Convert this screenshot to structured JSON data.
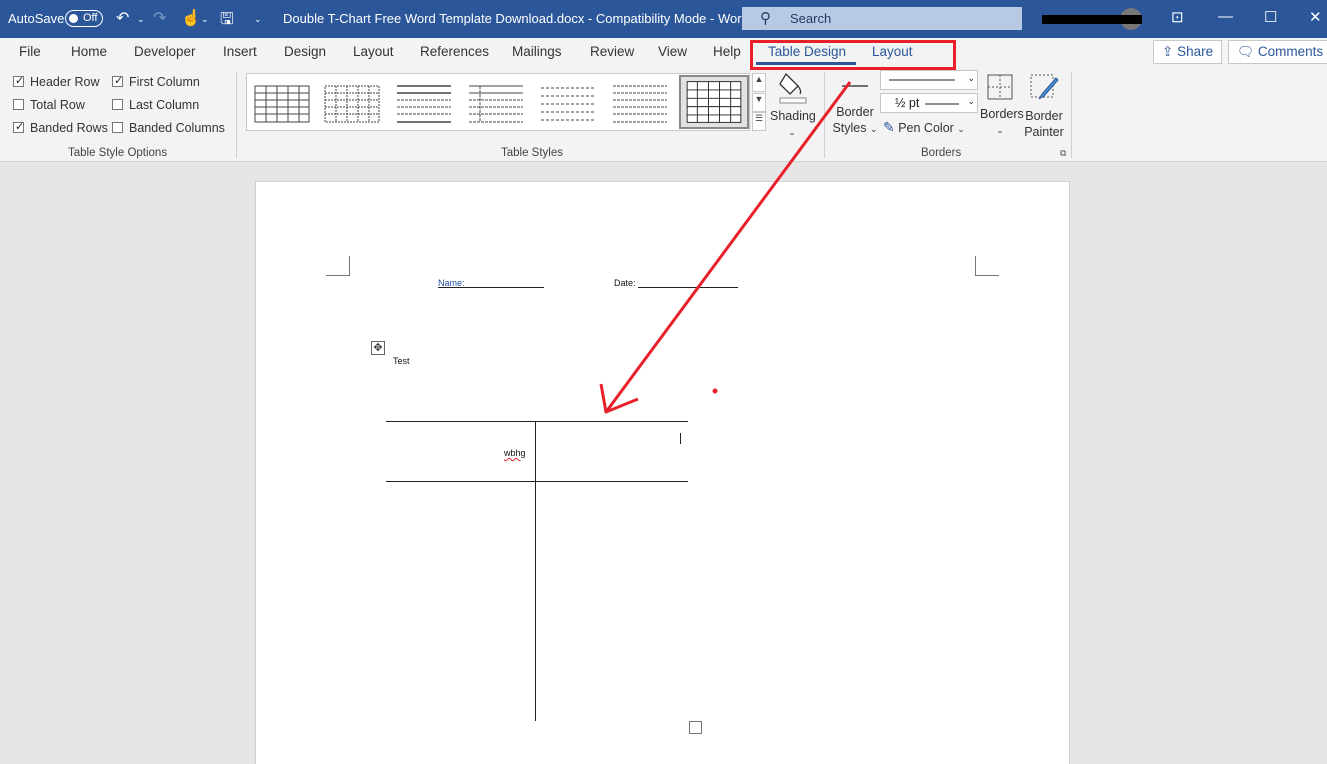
{
  "titlebar": {
    "autosave_label": "AutoSave",
    "autosave_state": "Off",
    "doc_title": "Double T-Chart Free Word Template Download.docx  -  Compatibility Mode  -  Word",
    "search_placeholder": "Search"
  },
  "tabs": [
    "File",
    "Home",
    "Developer",
    "Insert",
    "Design",
    "Layout",
    "References",
    "Mailings",
    "Review",
    "View",
    "Help",
    "Table Design",
    "Layout"
  ],
  "active_tab_index": 11,
  "share_label": "Share",
  "comments_label": "Comments",
  "table_style_options": {
    "group_label": "Table Style Options",
    "options": [
      {
        "label": "Header Row",
        "checked": true
      },
      {
        "label": "First Column",
        "checked": true
      },
      {
        "label": "Total Row",
        "checked": false
      },
      {
        "label": "Last Column",
        "checked": false
      },
      {
        "label": "Banded Rows",
        "checked": true
      },
      {
        "label": "Banded Columns",
        "checked": false
      }
    ]
  },
  "table_styles": {
    "group_label": "Table Styles",
    "shading_label": "Shading"
  },
  "borders_group": {
    "group_label": "Borders",
    "border_styles_line1": "Border",
    "border_styles_line2": "Styles",
    "weight": "½ pt",
    "pen_color": "Pen Color",
    "borders_label": "Borders",
    "painter_line1": "Border",
    "painter_line2": "Painter"
  },
  "document": {
    "name_label": "Name:",
    "date_label": "Date:",
    "test_text": "Test",
    "cell_text": "wbhg"
  },
  "colors": {
    "titlebar": "#2b579a",
    "annotation": "#e8202a"
  }
}
